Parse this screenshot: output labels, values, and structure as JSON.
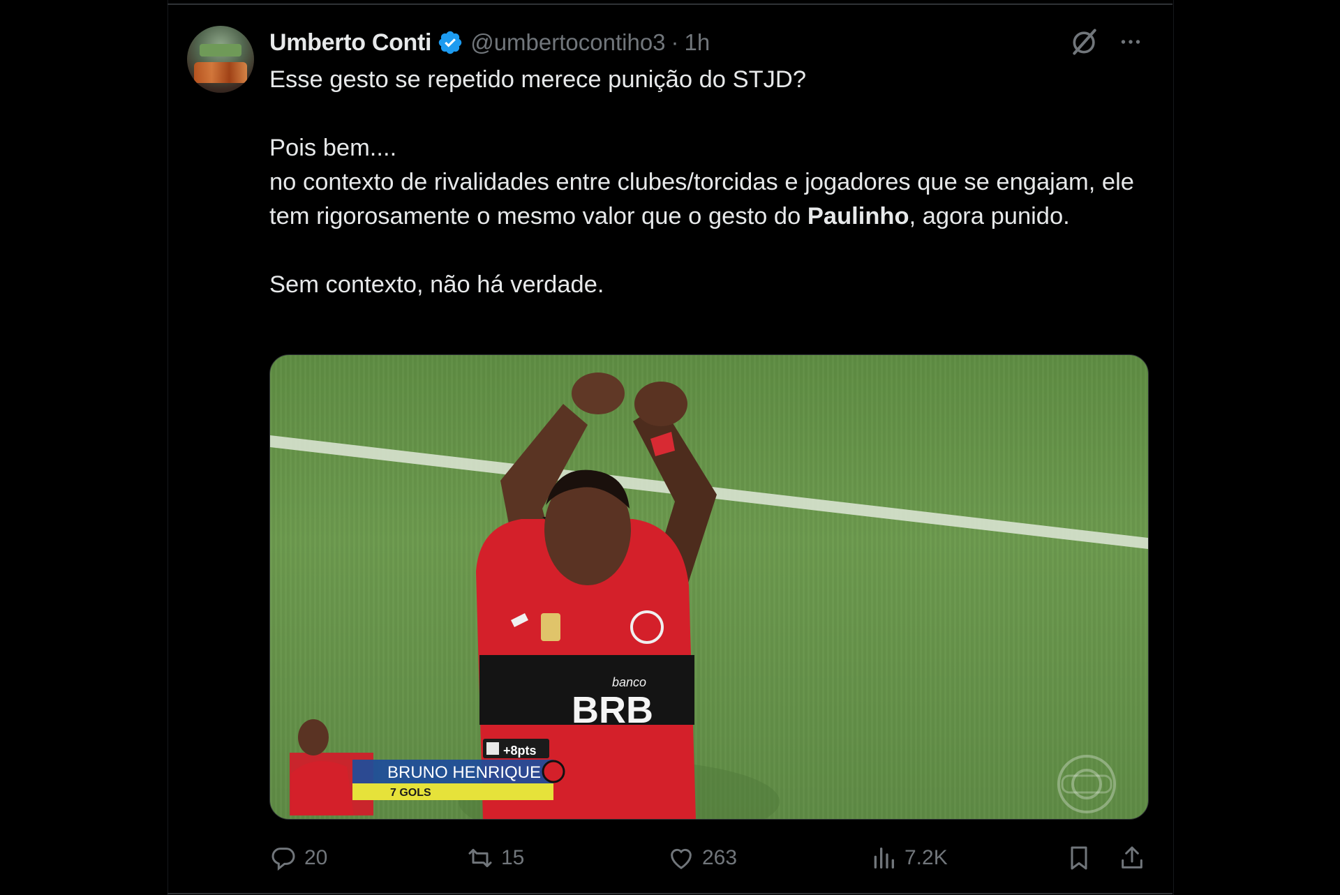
{
  "author": {
    "name": "Umberto Conti",
    "handle": "@umbertocontiho3",
    "separator": "·",
    "time": "1h",
    "verified": true
  },
  "tweet": {
    "line1": "Esse gesto se repetido merece punição do STJD?",
    "line2": "Pois bem....",
    "line3": "no contexto de rivalidades entre clubes/torcidas e jogadores que se engajam, ele tem rigorosamente o mesmo valor que o gesto do ",
    "line3_bold": "Paulinho",
    "line3_end": ", agora punido.",
    "line4": "Sem contexto, não há verdade."
  },
  "media": {
    "overlay_points": "+8pts",
    "overlay_player": "BRUNO HENRIQUE",
    "overlay_goals": "7 GOLS",
    "shirt_sponsor_small": "banco",
    "shirt_sponsor": "BRB"
  },
  "actions": {
    "replies": "20",
    "reposts": "15",
    "likes": "263",
    "views": "7.2K"
  },
  "icons": {
    "verified": "verified-badge-icon",
    "grok": "grok-icon",
    "more": "more-icon",
    "reply": "reply-icon",
    "repost": "repost-icon",
    "like": "heart-icon",
    "views": "views-icon",
    "bookmark": "bookmark-icon",
    "share": "share-icon"
  },
  "colors": {
    "background": "#000000",
    "text": "#e7e9ea",
    "secondary": "#71767b",
    "verified": "#1d9bf0",
    "flamengo_red": "#d4202a"
  }
}
